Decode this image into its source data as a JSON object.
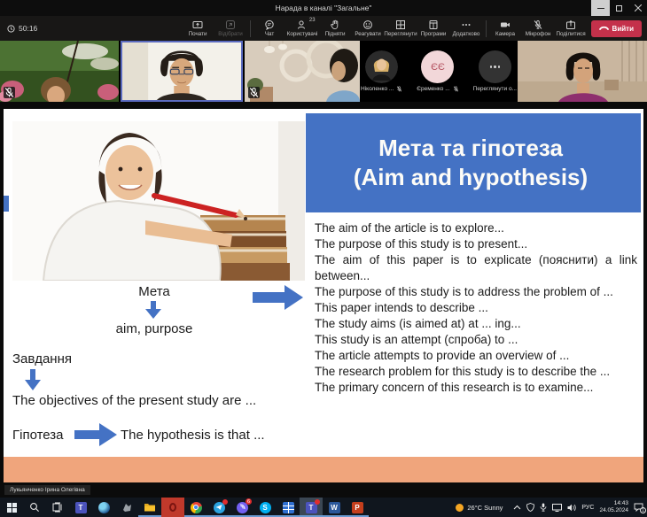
{
  "window": {
    "title": "Нарада в каналі \"Загальне\""
  },
  "toolbar": {
    "timer": "50:16",
    "start": "Почати",
    "takeback": "Відібрати",
    "chat": "Чат",
    "people": "Користувачі",
    "people_badge": "23",
    "raise": "Підняти",
    "react": "Реагувати",
    "view": "Переглянути",
    "apps": "Програми",
    "more": "Додатково",
    "camera": "Камера",
    "mic": "Мікрофон",
    "share": "Поділитися",
    "leave": "Вийти"
  },
  "participants": {
    "p1_name": "Ніколенко ...",
    "p2_name": "Єременко ...",
    "p2_initials": "ЄЄ",
    "p3_name": "Переглянути о..."
  },
  "slide": {
    "title1": "Мета та гіпотеза",
    "title2": "(Aim and hypothesis)",
    "meta": "Мета",
    "aim": "aim, purpose",
    "tasks": "Завдання",
    "objectives": "The objectives of the present study are ...",
    "hypothesis_label": "Гіпотеза",
    "hypothesis": "The hypothesis is that ...",
    "right_lines": [
      "The aim of the article is to explore...",
      "The purpose of this study is to present...",
      "The aim of this paper is to explicate (пояснити) a link between...",
      "The purpose of this study is to address the problem of ...",
      "This paper intends to describe ...",
      "The study aims (is aimed at) at ... ing...",
      "This study is an attempt (спроба) to ...",
      "The article attempts to provide an overview of ...",
      "The research problem for this study is to describe the ...",
      "The primary concern of this research is to examine..."
    ]
  },
  "presenter": {
    "name": "Лукьянченко Ірина Олегівна"
  },
  "taskbar": {
    "weather": "26°C Sunny",
    "lang": "РУС",
    "time": "14:43",
    "date": "24.05.2024",
    "viber_badge": "6",
    "notif_badge": "1",
    "letters": {
      "teams": "T",
      "skype": "S",
      "word": "W",
      "ppt": "P"
    }
  },
  "colors": {
    "accent_blue": "#4472C4",
    "salmon": "#F0A57C",
    "leave_red": "#C4314B"
  }
}
